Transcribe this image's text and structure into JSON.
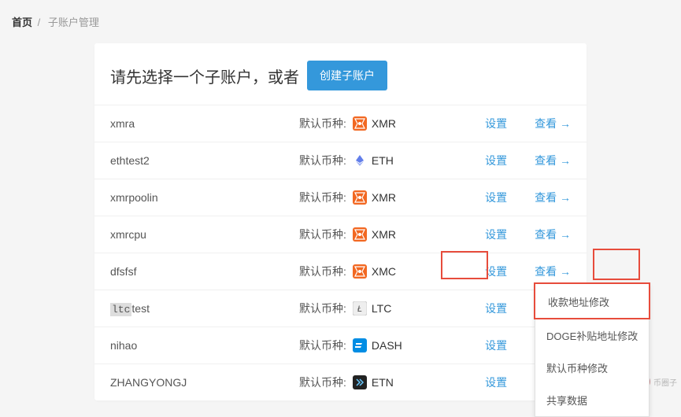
{
  "breadcrumb": {
    "home": "首页",
    "current": "子账户管理"
  },
  "header": {
    "title": "请先选择一个子账户，或者",
    "create_btn": "创建子账户"
  },
  "common": {
    "coin_label": "默认币种:",
    "settings": "设置",
    "view": "查看"
  },
  "rows": [
    {
      "name": "xmra",
      "coin": "XMR",
      "icon": "xmr"
    },
    {
      "name": "ethtest2",
      "coin": "ETH",
      "icon": "eth"
    },
    {
      "name": "xmrpoolin",
      "coin": "XMR",
      "icon": "xmr"
    },
    {
      "name": "xmrcpu",
      "coin": "XMR",
      "icon": "xmr"
    },
    {
      "name": "dfsfsf",
      "coin": "XMC",
      "icon": "xmr"
    },
    {
      "name": "ltctest",
      "coin": "LTC",
      "icon": "ltc",
      "highlight": true
    },
    {
      "name": "nihao",
      "coin": "DASH",
      "icon": "dash"
    },
    {
      "name": "ZHANGYONGJ",
      "coin": "ETN",
      "icon": "etn"
    }
  ],
  "dropdown": {
    "items": [
      "收款地址修改",
      "DOGE补贴地址修改",
      "默认币种修改",
      "共享数据"
    ]
  },
  "watermark": "币圈子"
}
